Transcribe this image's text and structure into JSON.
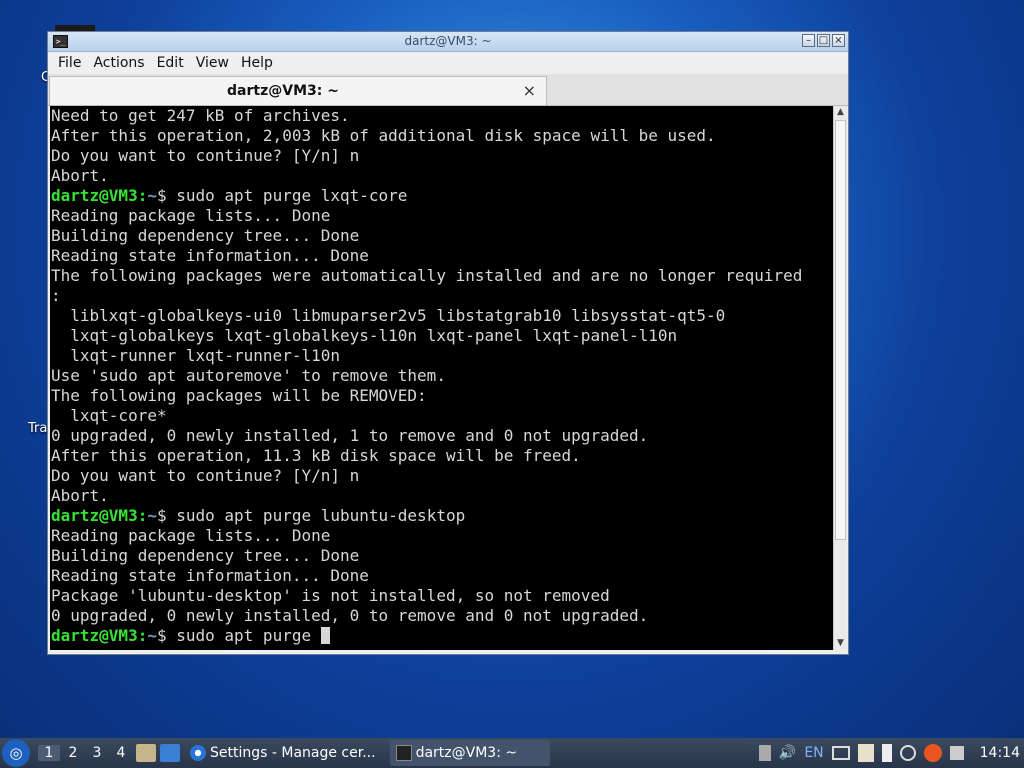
{
  "desktop": {
    "label_1": "C",
    "label_2": "Tra"
  },
  "window": {
    "title": "dartz@VM3: ~",
    "app_icon": ">_",
    "minimize": "–",
    "maximize": "□",
    "close": "×"
  },
  "menu": {
    "file": "File",
    "actions": "Actions",
    "edit": "Edit",
    "view": "View",
    "help": "Help"
  },
  "tab": {
    "title": "dartz@VM3: ~",
    "close": "×"
  },
  "terminal": {
    "prompt_user": "dartz@VM3",
    "prompt_sep": ":",
    "prompt_path": "~",
    "prompt_end": "$ ",
    "lines": [
      {
        "type": "out",
        "text": "Need to get 247 kB of archives."
      },
      {
        "type": "out",
        "text": "After this operation, 2,003 kB of additional disk space will be used."
      },
      {
        "type": "out",
        "text": "Do you want to continue? [Y/n] n"
      },
      {
        "type": "out",
        "text": "Abort."
      },
      {
        "type": "cmd",
        "text": "sudo apt purge lxqt-core"
      },
      {
        "type": "out",
        "text": "Reading package lists... Done"
      },
      {
        "type": "out",
        "text": "Building dependency tree... Done"
      },
      {
        "type": "out",
        "text": "Reading state information... Done"
      },
      {
        "type": "out",
        "text": "The following packages were automatically installed and are no longer required"
      },
      {
        "type": "out",
        "text": ":"
      },
      {
        "type": "out",
        "text": "  liblxqt-globalkeys-ui0 libmuparser2v5 libstatgrab10 libsysstat-qt5-0"
      },
      {
        "type": "out",
        "text": "  lxqt-globalkeys lxqt-globalkeys-l10n lxqt-panel lxqt-panel-l10n"
      },
      {
        "type": "out",
        "text": "  lxqt-runner lxqt-runner-l10n"
      },
      {
        "type": "out",
        "text": "Use 'sudo apt autoremove' to remove them."
      },
      {
        "type": "out",
        "text": "The following packages will be REMOVED:"
      },
      {
        "type": "out",
        "text": "  lxqt-core*"
      },
      {
        "type": "out",
        "text": "0 upgraded, 0 newly installed, 1 to remove and 0 not upgraded."
      },
      {
        "type": "out",
        "text": "After this operation, 11.3 kB disk space will be freed."
      },
      {
        "type": "out",
        "text": "Do you want to continue? [Y/n] n"
      },
      {
        "type": "out",
        "text": "Abort."
      },
      {
        "type": "cmd",
        "text": "sudo apt purge lubuntu-desktop"
      },
      {
        "type": "out",
        "text": "Reading package lists... Done"
      },
      {
        "type": "out",
        "text": "Building dependency tree... Done"
      },
      {
        "type": "out",
        "text": "Reading state information... Done"
      },
      {
        "type": "out",
        "text": "Package 'lubuntu-desktop' is not installed, so not removed"
      },
      {
        "type": "out",
        "text": "0 upgraded, 0 newly installed, 0 to remove and 0 not upgraded."
      },
      {
        "type": "cmd",
        "text": "sudo apt purge ",
        "cursor": true
      }
    ]
  },
  "taskbar": {
    "desktops": [
      "1",
      "2",
      "3",
      "4"
    ],
    "active_desktop": "1",
    "tasks": [
      {
        "label": "Settings - Manage cer...",
        "icon": "chromium-icon"
      },
      {
        "label": "dartz@VM3: ~",
        "icon": "terminal-icon"
      }
    ],
    "keyboard_layout": "EN",
    "clock": "14:14",
    "colors": {
      "accent": "#1e5fbf",
      "prompt_user": "#34e234",
      "prompt_path": "#729fcf"
    }
  }
}
